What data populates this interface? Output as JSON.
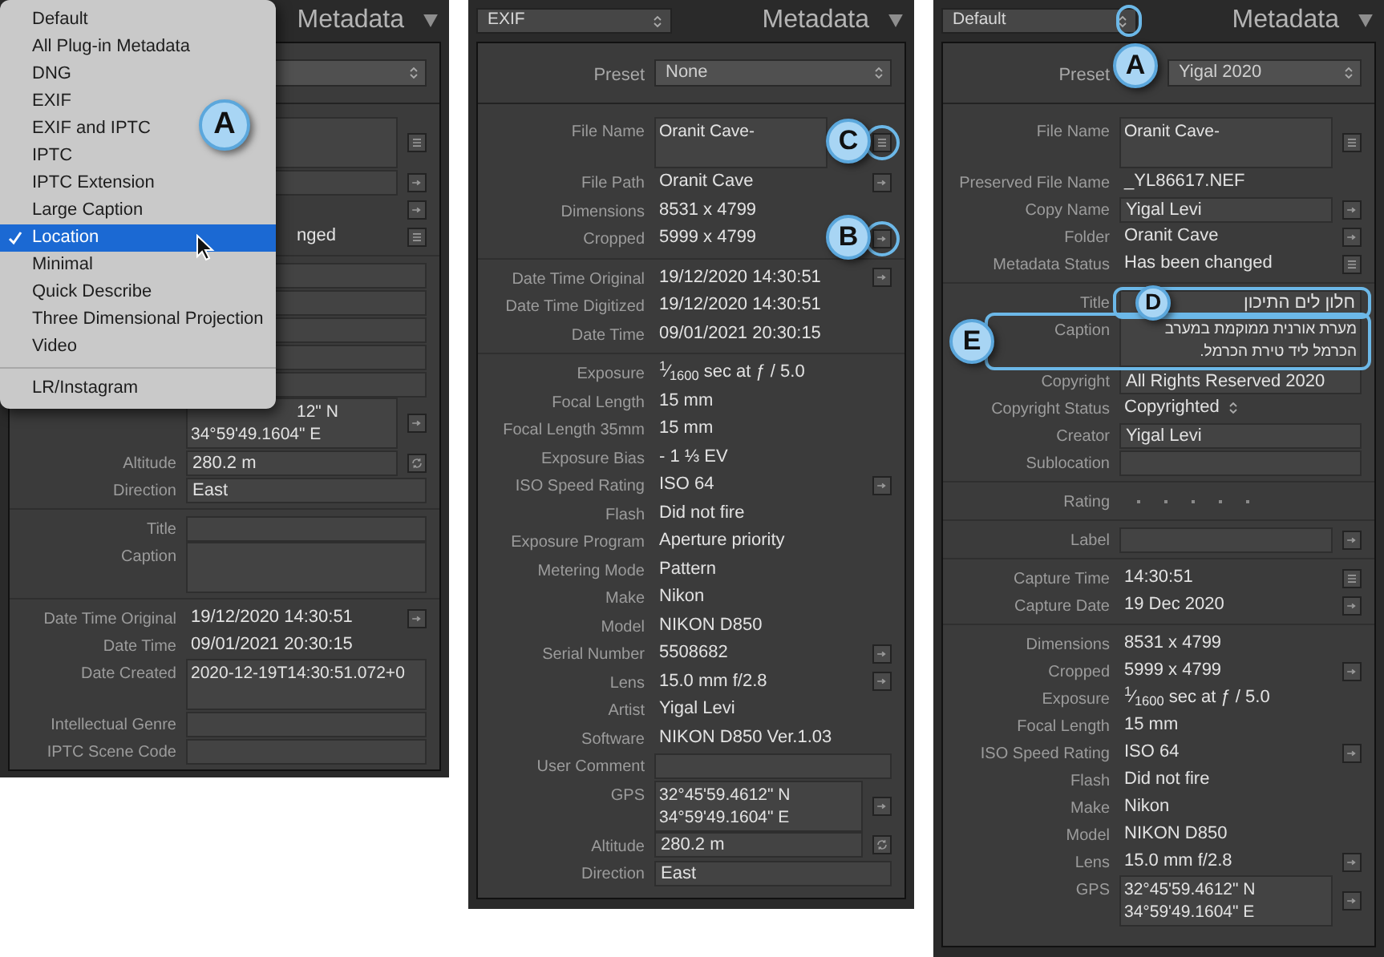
{
  "panels": [
    {
      "header": {
        "title": "Metadata"
      },
      "menu": {
        "groups": [
          {
            "items": [
              {
                "label": "Default",
                "selected": false
              },
              {
                "label": "All Plug-in Metadata",
                "selected": false
              },
              {
                "label": "DNG",
                "selected": false
              },
              {
                "label": "EXIF",
                "selected": false
              },
              {
                "label": "EXIF and IPTC",
                "selected": false,
                "callout": "A"
              },
              {
                "label": "IPTC",
                "selected": false
              },
              {
                "label": "IPTC Extension",
                "selected": false
              },
              {
                "label": "Large Caption",
                "selected": false
              },
              {
                "label": "Location",
                "selected": true
              },
              {
                "label": "Minimal",
                "selected": false
              },
              {
                "label": "Quick Describe",
                "selected": false
              },
              {
                "label": "Three Dimensional Projection",
                "selected": false
              },
              {
                "label": "Video",
                "selected": false
              }
            ]
          },
          {
            "items": [
              {
                "label": "LR/Instagram",
                "selected": false
              }
            ]
          }
        ]
      },
      "sections": [
        {
          "rows": [
            {
              "kind": "area",
              "action": {
                "kind": "list"
              }
            },
            {
              "kind": "field",
              "action": {
                "kind": "arrow"
              }
            },
            {
              "kind": "text",
              "action": {
                "kind": "arrow"
              }
            },
            {
              "kind": "text",
              "lines": [
                {
                  "text": "nged",
                  "covered": true
                }
              ],
              "action": {
                "kind": "list"
              }
            }
          ]
        },
        {
          "rows": [
            {
              "kind": "field"
            },
            {
              "kind": "field"
            },
            {
              "kind": "field"
            },
            {
              "kind": "field"
            },
            {
              "kind": "field"
            },
            {
              "kind": "area",
              "lines": [
                {
                  "text": "12\" N",
                  "covered": true
                },
                {
                  "text": "34°59'49.1604\" E"
                }
              ],
              "action": {
                "kind": "arrow"
              }
            },
            {
              "label": "Altitude",
              "kind": "field",
              "lines": [
                {
                  "text": "280.2 m"
                }
              ],
              "action": {
                "kind": "sync"
              }
            },
            {
              "label": "Direction",
              "kind": "field",
              "lines": [
                {
                  "text": "East"
                }
              ]
            }
          ]
        },
        {
          "rows": [
            {
              "label": "Title",
              "kind": "field"
            },
            {
              "label": "Caption",
              "kind": "area"
            }
          ]
        },
        {
          "rows": [
            {
              "label": "Date Time Original",
              "kind": "text",
              "lines": [
                {
                  "text": "19/12/2020 14:30:51"
                }
              ],
              "action": {
                "kind": "arrow"
              }
            },
            {
              "label": "Date Time",
              "kind": "text",
              "lines": [
                {
                  "text": "09/01/2021 20:30:15"
                }
              ]
            },
            {
              "label": "Date Created",
              "kind": "area",
              "lines": [
                {
                  "text": "2020-12-19T14:30:51.072+0"
                }
              ]
            },
            {
              "label": "Intellectual Genre",
              "kind": "field"
            },
            {
              "label": "IPTC Scene Code",
              "kind": "field"
            }
          ]
        }
      ]
    },
    {
      "header": {
        "dropdown": "EXIF",
        "title": "Metadata"
      },
      "preset": {
        "label": "Preset",
        "value": "None"
      },
      "sections": [
        {
          "rows": [
            {
              "label": "File Name",
              "kind": "area",
              "lines": [
                {
                  "text": "Oranit Cave-"
                }
              ],
              "action": {
                "kind": "list"
              },
              "callout": {
                "letter": "C",
                "kind": "icon"
              }
            },
            {
              "label": "File Path",
              "kind": "text",
              "lines": [
                {
                  "text": "Oranit Cave"
                }
              ],
              "action": {
                "kind": "arrow"
              }
            },
            {
              "label": "Dimensions",
              "kind": "text",
              "lines": [
                {
                  "text": "8531 x 4799"
                }
              ]
            },
            {
              "label": "Cropped",
              "kind": "text",
              "lines": [
                {
                  "text": "5999 x 4799"
                }
              ],
              "action": {
                "kind": "arrow"
              },
              "callout": {
                "letter": "B",
                "kind": "icon"
              }
            }
          ]
        },
        {
          "rows": [
            {
              "label": "Date Time Original",
              "kind": "text",
              "lines": [
                {
                  "text": "19/12/2020 14:30:51"
                }
              ],
              "action": {
                "kind": "arrow"
              }
            },
            {
              "label": "Date Time Digitized",
              "kind": "text",
              "lines": [
                {
                  "text": "19/12/2020 14:30:51"
                }
              ]
            },
            {
              "label": "Date Time",
              "kind": "text",
              "lines": [
                {
                  "text": "09/01/2021 20:30:15"
                }
              ]
            }
          ]
        },
        {
          "rows": [
            {
              "label": "Exposure",
              "kind": "text",
              "lines": [
                {
                  "text": "$^{1}$⁄$_{1600}$ sec at ƒ / 5.0"
                }
              ]
            },
            {
              "label": "Focal Length",
              "kind": "text",
              "lines": [
                {
                  "text": "15 mm"
                }
              ]
            },
            {
              "label": "Focal Length 35mm",
              "kind": "text",
              "lines": [
                {
                  "text": "15 mm"
                }
              ]
            },
            {
              "label": "Exposure Bias",
              "kind": "text",
              "lines": [
                {
                  "text": "- 1 ⅓ EV"
                }
              ]
            },
            {
              "label": "ISO Speed Rating",
              "kind": "text",
              "lines": [
                {
                  "text": "ISO 64"
                }
              ],
              "action": {
                "kind": "arrow"
              }
            },
            {
              "label": "Flash",
              "kind": "text",
              "lines": [
                {
                  "text": "Did not fire"
                }
              ]
            },
            {
              "label": "Exposure Program",
              "kind": "text",
              "lines": [
                {
                  "text": "Aperture priority"
                }
              ]
            },
            {
              "label": "Metering Mode",
              "kind": "text",
              "lines": [
                {
                  "text": "Pattern"
                }
              ]
            },
            {
              "label": "Make",
              "kind": "text",
              "lines": [
                {
                  "text": "Nikon"
                }
              ]
            },
            {
              "label": "Model",
              "kind": "text",
              "lines": [
                {
                  "text": "NIKON D850"
                }
              ]
            },
            {
              "label": "Serial Number",
              "kind": "text",
              "lines": [
                {
                  "text": "5508682"
                }
              ],
              "action": {
                "kind": "arrow"
              }
            },
            {
              "label": "Lens",
              "kind": "text",
              "lines": [
                {
                  "text": "15.0 mm f/2.8"
                }
              ],
              "action": {
                "kind": "arrow"
              }
            },
            {
              "label": "Artist",
              "kind": "text",
              "lines": [
                {
                  "text": "Yigal Levi"
                }
              ]
            },
            {
              "label": "Software",
              "kind": "text",
              "lines": [
                {
                  "text": "NIKON D850 Ver.1.03"
                }
              ]
            },
            {
              "label": "User Comment",
              "kind": "field"
            },
            {
              "label": "GPS",
              "kind": "area",
              "lines": [
                {
                  "text": "32°45'59.4612\" N"
                },
                {
                  "text": "34°59'49.1604\" E"
                }
              ],
              "action": {
                "kind": "arrow"
              }
            },
            {
              "label": "Altitude",
              "kind": "field",
              "lines": [
                {
                  "text": "280.2 m"
                }
              ],
              "action": {
                "kind": "sync"
              }
            },
            {
              "label": "Direction",
              "kind": "field",
              "lines": [
                {
                  "text": "East"
                }
              ]
            }
          ]
        }
      ]
    },
    {
      "header": {
        "dropdown": "Default",
        "title": "Metadata",
        "callout": "A"
      },
      "preset": {
        "label": "Preset",
        "value": "Yigal 2020"
      },
      "sections": [
        {
          "rows": [
            {
              "label": "File Name",
              "kind": "area",
              "lines": [
                {
                  "text": "Oranit Cave-"
                }
              ],
              "action": {
                "kind": "list"
              }
            },
            {
              "label": "Preserved File Name",
              "kind": "text",
              "lines": [
                {
                  "text": "_YL86617.NEF"
                }
              ]
            },
            {
              "label": "Copy Name",
              "kind": "field",
              "lines": [
                {
                  "text": "Yigal Levi"
                }
              ],
              "action": {
                "kind": "arrow"
              }
            },
            {
              "label": "Folder",
              "kind": "text",
              "lines": [
                {
                  "text": "Oranit Cave"
                }
              ],
              "action": {
                "kind": "arrow"
              }
            },
            {
              "label": "Metadata Status",
              "kind": "text",
              "lines": [
                {
                  "text": "Has been changed"
                }
              ],
              "action": {
                "kind": "list"
              }
            }
          ]
        },
        {
          "rows": [
            {
              "label": "Title",
              "kind": "field",
              "rtl": true,
              "lines": [
                {
                  "text": "חלון לים התיכון"
                }
              ],
              "callout": {
                "letter": "D",
                "kind": "value"
              }
            },
            {
              "label": "Caption",
              "kind": "area",
              "rtl": true,
              "lines": [
                {
                  "text": "מערת אורנית ממוקמת במערב"
                },
                {
                  "text": "הכרמל ליד טירת הכרמל."
                }
              ],
              "callout": {
                "letter": "E",
                "kind": "row"
              }
            },
            {
              "label": "Copyright",
              "kind": "field",
              "lines": [
                {
                  "text": "All Rights Reserved 2020"
                }
              ]
            },
            {
              "label": "Copyright Status",
              "kind": "select",
              "lines": [
                {
                  "text": "Copyrighted"
                }
              ]
            },
            {
              "label": "Creator",
              "kind": "field",
              "lines": [
                {
                  "text": "Yigal Levi"
                }
              ]
            },
            {
              "label": "Sublocation",
              "kind": "field"
            }
          ]
        },
        {
          "rows": [
            {
              "label": "Rating",
              "kind": "stars",
              "stars": 0
            }
          ]
        },
        {
          "rows": [
            {
              "label": "Label",
              "kind": "field",
              "action": {
                "kind": "arrow"
              }
            }
          ]
        },
        {
          "rows": [
            {
              "label": "Capture Time",
              "kind": "text",
              "lines": [
                {
                  "text": "14:30:51"
                }
              ],
              "action": {
                "kind": "list"
              }
            },
            {
              "label": "Capture Date",
              "kind": "text",
              "lines": [
                {
                  "text": "19 Dec 2020"
                }
              ],
              "action": {
                "kind": "arrow"
              }
            }
          ]
        },
        {
          "rows": [
            {
              "label": "Dimensions",
              "kind": "text",
              "lines": [
                {
                  "text": "8531 x 4799"
                }
              ]
            },
            {
              "label": "Cropped",
              "kind": "text",
              "lines": [
                {
                  "text": "5999 x 4799"
                }
              ],
              "action": {
                "kind": "arrow"
              }
            },
            {
              "label": "Exposure",
              "kind": "text",
              "lines": [
                {
                  "text": "$^{1}$⁄$_{1600}$ sec at ƒ / 5.0"
                }
              ]
            },
            {
              "label": "Focal Length",
              "kind": "text",
              "lines": [
                {
                  "text": "15 mm"
                }
              ]
            },
            {
              "label": "ISO Speed Rating",
              "kind": "text",
              "lines": [
                {
                  "text": "ISO 64"
                }
              ],
              "action": {
                "kind": "arrow"
              }
            },
            {
              "label": "Flash",
              "kind": "text",
              "lines": [
                {
                  "text": "Did not fire"
                }
              ]
            },
            {
              "label": "Make",
              "kind": "text",
              "lines": [
                {
                  "text": "Nikon"
                }
              ]
            },
            {
              "label": "Model",
              "kind": "text",
              "lines": [
                {
                  "text": "NIKON D850"
                }
              ]
            },
            {
              "label": "Lens",
              "kind": "text",
              "lines": [
                {
                  "text": "15.0 mm f/2.8"
                }
              ],
              "action": {
                "kind": "arrow"
              }
            },
            {
              "label": "GPS",
              "kind": "area",
              "lines": [
                {
                  "text": "32°45'59.4612\" N"
                },
                {
                  "text": "34°59'49.1604\" E"
                }
              ],
              "action": {
                "kind": "arrow"
              }
            }
          ]
        }
      ]
    }
  ]
}
